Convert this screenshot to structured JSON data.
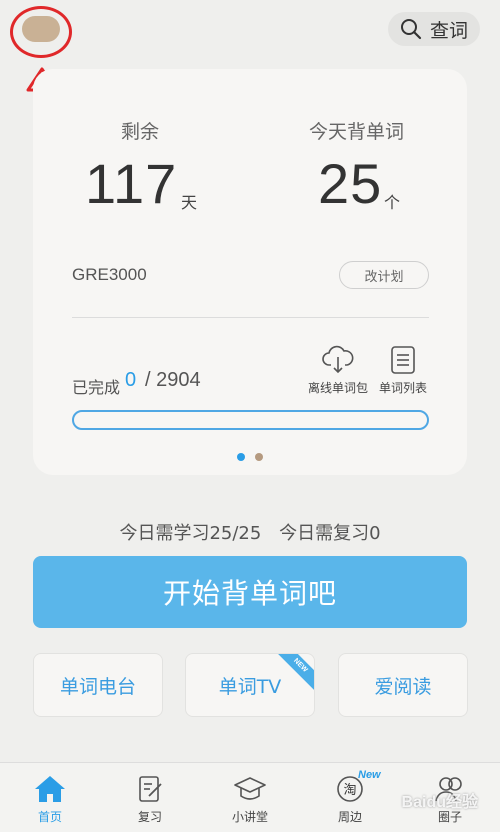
{
  "header": {
    "search_label": "查词"
  },
  "card": {
    "remaining_label": "剩余",
    "remaining_value": "117",
    "remaining_unit": "天",
    "today_label": "今天背单词",
    "today_value": "25",
    "today_unit": "个",
    "book_name": "GRE3000",
    "change_plan_label": "改计划",
    "completed_label": "已完成",
    "completed_count": "0",
    "completed_total": "/ 2904",
    "progress_fraction": 0,
    "tools": {
      "offline_pack_label": "离线单词包",
      "word_list_label": "单词列表"
    },
    "page_dots": {
      "count": 2,
      "active_index": 0,
      "active_color": "#2a9de6",
      "inactive_color": "#b59a80"
    }
  },
  "today_summary": {
    "learn_text": "今日需学习25/25",
    "review_text": "今日需复习0"
  },
  "start_button_label": "开始背单词吧",
  "tiles": {
    "radio_label": "单词电台",
    "tv_label": "单词TV",
    "tv_badge": "NEW",
    "reading_label": "爱阅读"
  },
  "nav": {
    "items": [
      {
        "label": "首页",
        "icon": "home-icon",
        "active": true
      },
      {
        "label": "复习",
        "icon": "review-icon",
        "active": false
      },
      {
        "label": "小讲堂",
        "icon": "graduation-cap-icon",
        "active": false
      },
      {
        "label": "周边",
        "icon": "taobao-icon",
        "active": false
      },
      {
        "label": "圈子",
        "icon": "people-icon",
        "active": false
      }
    ],
    "new_badge": "New",
    "taobao_glyph": "淘"
  },
  "colors": {
    "accent": "#2a9de6",
    "button": "#5ab6ea",
    "annotation": "#e0282a"
  },
  "watermark": "Baidu经验"
}
